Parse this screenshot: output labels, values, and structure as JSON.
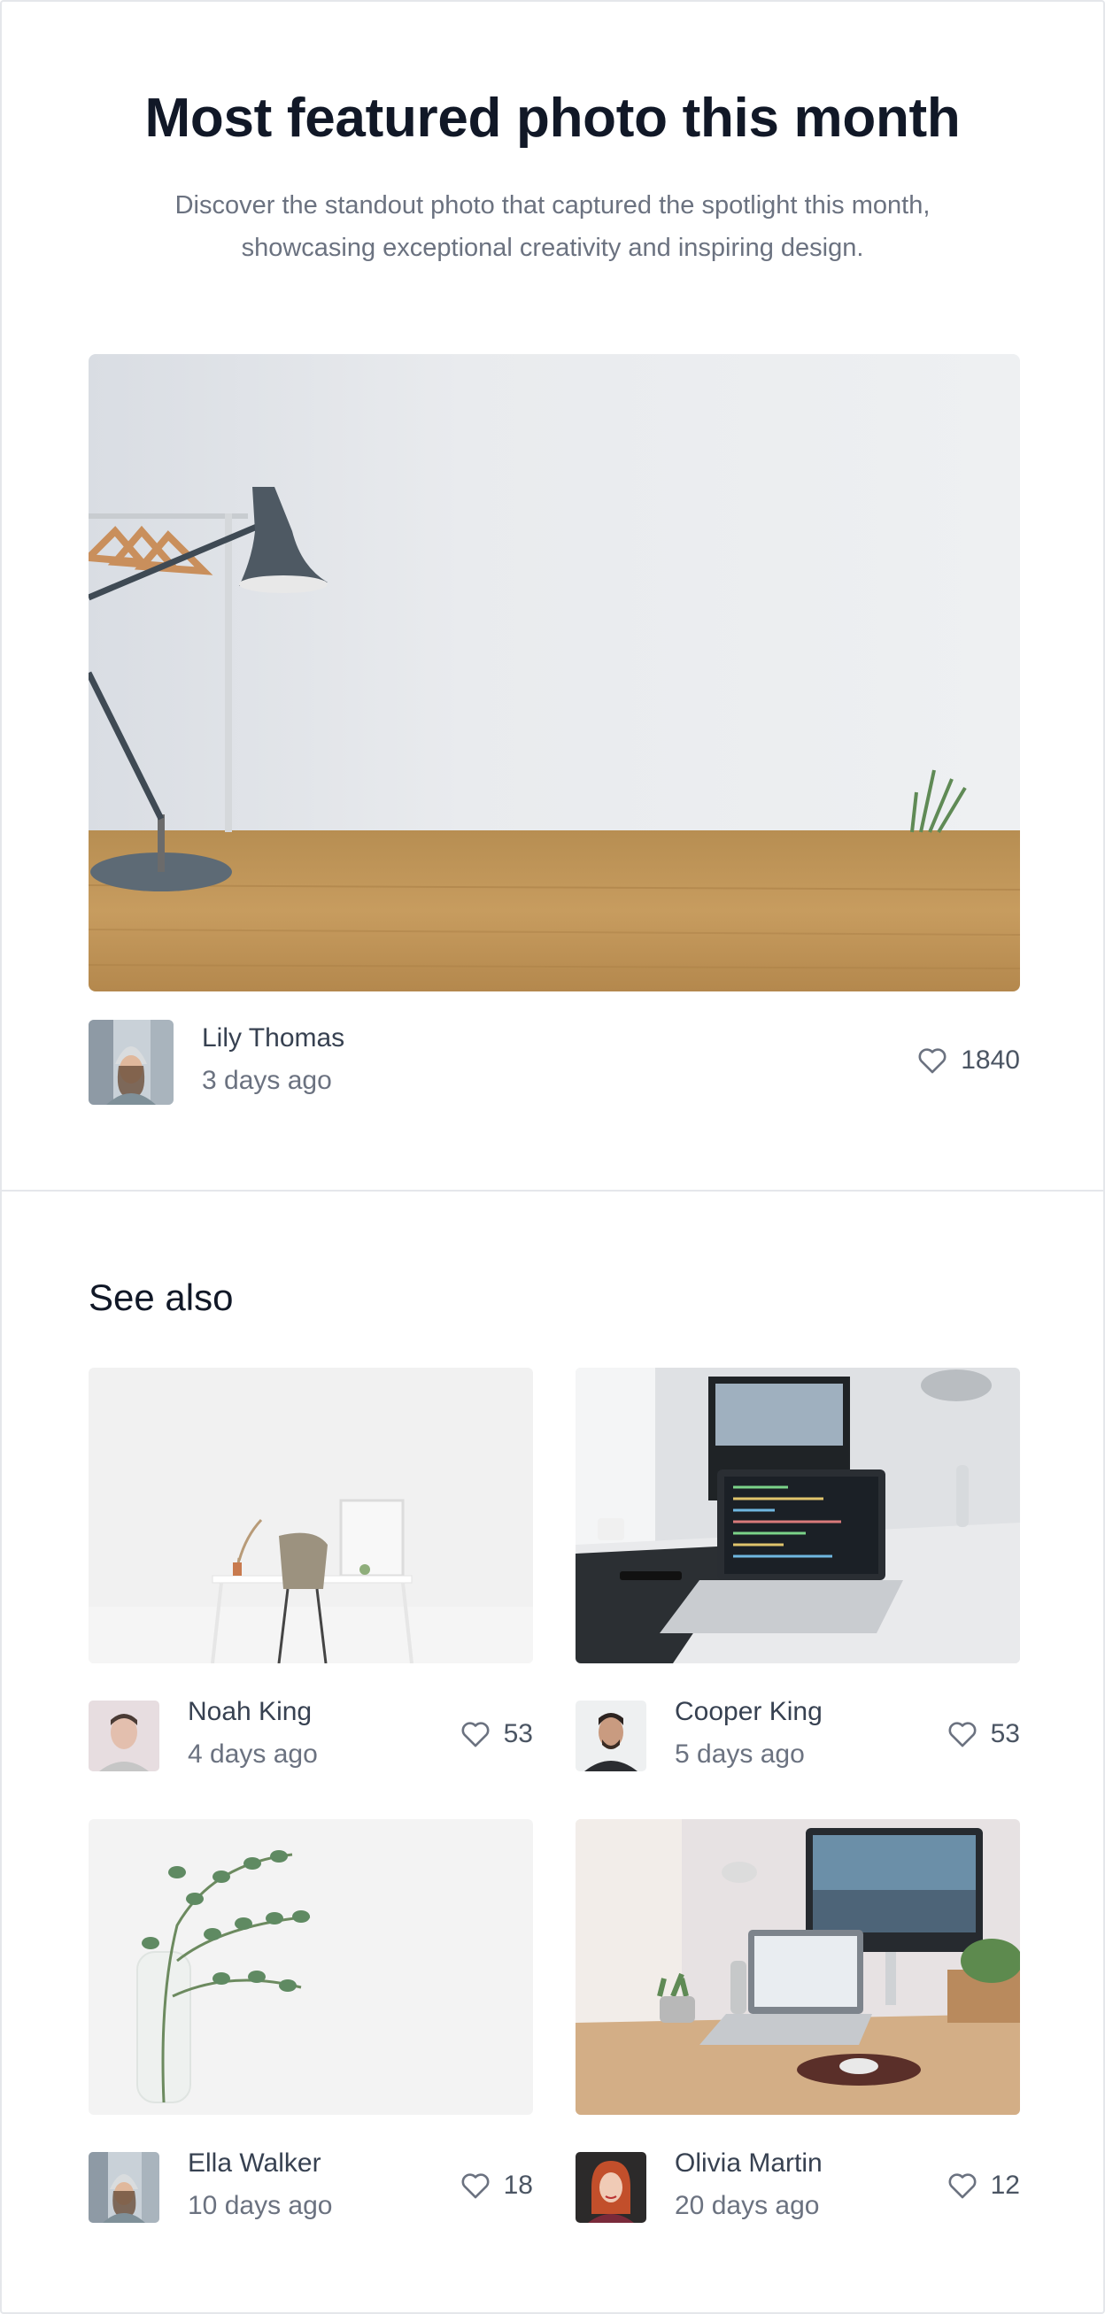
{
  "featured": {
    "title": "Most featured photo this month",
    "description": "Discover the standout photo that captured the spotlight this month, showcasing exceptional creativity and inspiring design.",
    "photo": {
      "subject": "Desk lamp and clothes rack on a wooden table"
    },
    "author": {
      "name": "Lily Thomas",
      "time": "3 days ago"
    },
    "likes": "1840"
  },
  "see_also": {
    "title": "See also",
    "items": [
      {
        "author": "Noah King",
        "time": "4 days ago",
        "likes": "53",
        "photo": "minimal white desk with chair"
      },
      {
        "author": "Cooper King",
        "time": "5 days ago",
        "likes": "53",
        "photo": "laptop with code on desk"
      },
      {
        "author": "Ella Walker",
        "time": "10 days ago",
        "likes": "18",
        "photo": "eucalyptus branch in glass vase"
      },
      {
        "author": "Olivia Martin",
        "time": "20 days ago",
        "likes": "12",
        "photo": "laptop and monitor workspace"
      }
    ]
  },
  "icons": {
    "like": "heart-icon"
  },
  "colors": {
    "heading": "#111827",
    "muted": "#6b7280",
    "border": "#e5e7eb"
  }
}
